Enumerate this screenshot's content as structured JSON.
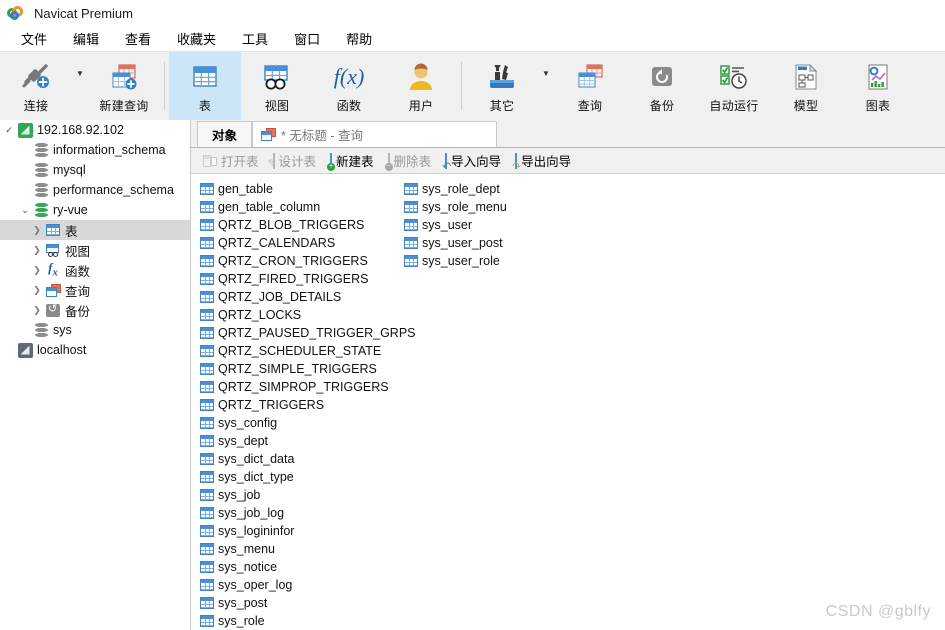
{
  "window": {
    "title": "Navicat Premium",
    "logo_icon": "navicat-logo-icon"
  },
  "menubar": {
    "items": [
      {
        "label": "文件"
      },
      {
        "label": "编辑"
      },
      {
        "label": "查看"
      },
      {
        "label": "收藏夹"
      },
      {
        "label": "工具"
      },
      {
        "label": "窗口"
      },
      {
        "label": "帮助"
      }
    ]
  },
  "toolbar": {
    "buttons": [
      {
        "label": "连接",
        "icon": "connection-plug-icon",
        "has_caret": true,
        "active": false
      },
      {
        "label": "新建查询",
        "icon": "new-query-grid-icon",
        "has_caret": false,
        "active": false
      },
      {
        "label": "表",
        "icon": "table-grid-icon",
        "has_caret": false,
        "active": true
      },
      {
        "label": "视图",
        "icon": "view-goggles-icon",
        "has_caret": false,
        "active": false
      },
      {
        "label": "函数",
        "icon": "function-fx-icon",
        "has_caret": false,
        "active": false
      },
      {
        "label": "用户",
        "icon": "user-avatar-icon",
        "has_caret": false,
        "active": false
      },
      {
        "label": "其它",
        "icon": "other-tools-icon",
        "has_caret": true,
        "active": false
      },
      {
        "label": "查询",
        "icon": "query-grid-icon",
        "has_caret": false,
        "active": false
      },
      {
        "label": "备份",
        "icon": "backup-disk-icon",
        "has_caret": false,
        "active": false
      },
      {
        "label": "自动运行",
        "icon": "automation-clock-icon",
        "has_caret": false,
        "active": false
      },
      {
        "label": "模型",
        "icon": "model-diagram-icon",
        "has_caret": false,
        "active": false
      },
      {
        "label": "图表",
        "icon": "chart-report-icon",
        "has_caret": false,
        "active": false
      }
    ]
  },
  "sidebar": {
    "nodes": [
      {
        "label": "192.168.92.102",
        "icon": "connection-icon-green",
        "indent": 0,
        "arrow": "open",
        "selected": false
      },
      {
        "label": "information_schema",
        "icon": "database-icon-grey",
        "indent": 1,
        "arrow": "none",
        "selected": false
      },
      {
        "label": "mysql",
        "icon": "database-icon-grey",
        "indent": 1,
        "arrow": "none",
        "selected": false
      },
      {
        "label": "performance_schema",
        "icon": "database-icon-grey",
        "indent": 1,
        "arrow": "none",
        "selected": false
      },
      {
        "label": "ry-vue",
        "icon": "database-icon-green",
        "indent": 1,
        "arrow": "open",
        "selected": false
      },
      {
        "label": "表",
        "icon": "table-grid-icon",
        "indent": 2,
        "arrow": "closed",
        "selected": true
      },
      {
        "label": "视图",
        "icon": "view-goggles-icon",
        "indent": 2,
        "arrow": "closed",
        "selected": false
      },
      {
        "label": "函数",
        "icon": "function-fx-icon",
        "indent": 2,
        "arrow": "closed",
        "selected": false
      },
      {
        "label": "查询",
        "icon": "query-grid-icon",
        "indent": 2,
        "arrow": "closed",
        "selected": false
      },
      {
        "label": "备份",
        "icon": "backup-disk-icon",
        "indent": 2,
        "arrow": "closed",
        "selected": false
      },
      {
        "label": "sys",
        "icon": "database-icon-grey",
        "indent": 1,
        "arrow": "none",
        "selected": false
      },
      {
        "label": "localhost",
        "icon": "connection-icon-grey",
        "indent": 0,
        "arrow": "none",
        "selected": false
      }
    ]
  },
  "tabs": [
    {
      "label": "对象",
      "icon": "none",
      "active": true
    },
    {
      "label": "* 无标题 - 查询",
      "icon": "query-grid-icon",
      "active": false
    }
  ],
  "object_toolbar": {
    "buttons": [
      {
        "label": "打开表",
        "icon": "open-table-icon",
        "enabled": false
      },
      {
        "label": "设计表",
        "icon": "design-table-icon",
        "enabled": false
      },
      {
        "label": "新建表",
        "icon": "new-table-icon",
        "enabled": true
      },
      {
        "label": "删除表",
        "icon": "delete-table-icon",
        "enabled": false
      },
      {
        "label": "导入向导",
        "icon": "import-wizard-icon",
        "enabled": true
      },
      {
        "label": "导出向导",
        "icon": "export-wizard-icon",
        "enabled": true
      }
    ]
  },
  "table_list": {
    "icon": "table-grid-icon",
    "column1": [
      "gen_table",
      "gen_table_column",
      "QRTZ_BLOB_TRIGGERS",
      "QRTZ_CALENDARS",
      "QRTZ_CRON_TRIGGERS",
      "QRTZ_FIRED_TRIGGERS",
      "QRTZ_JOB_DETAILS",
      "QRTZ_LOCKS",
      "QRTZ_PAUSED_TRIGGER_GRPS",
      "QRTZ_SCHEDULER_STATE",
      "QRTZ_SIMPLE_TRIGGERS",
      "QRTZ_SIMPROP_TRIGGERS",
      "QRTZ_TRIGGERS",
      "sys_config",
      "sys_dept",
      "sys_dict_data",
      "sys_dict_type",
      "sys_job",
      "sys_job_log",
      "sys_logininfor",
      "sys_menu",
      "sys_notice",
      "sys_oper_log",
      "sys_post",
      "sys_role"
    ],
    "column2": [
      "sys_role_dept",
      "sys_role_menu",
      "sys_user",
      "sys_user_post",
      "sys_user_role"
    ]
  },
  "watermark": {
    "text": "CSDN @gblfy"
  },
  "colors": {
    "accent_blue": "#4a90d9",
    "active_tab_bg": "#cde6f7",
    "toolbar_bg": "#f0f0f0",
    "selection_grey": "#d8d8d8",
    "db_green": "#2fa84f",
    "watermark_grey": "#c9c9c9"
  }
}
